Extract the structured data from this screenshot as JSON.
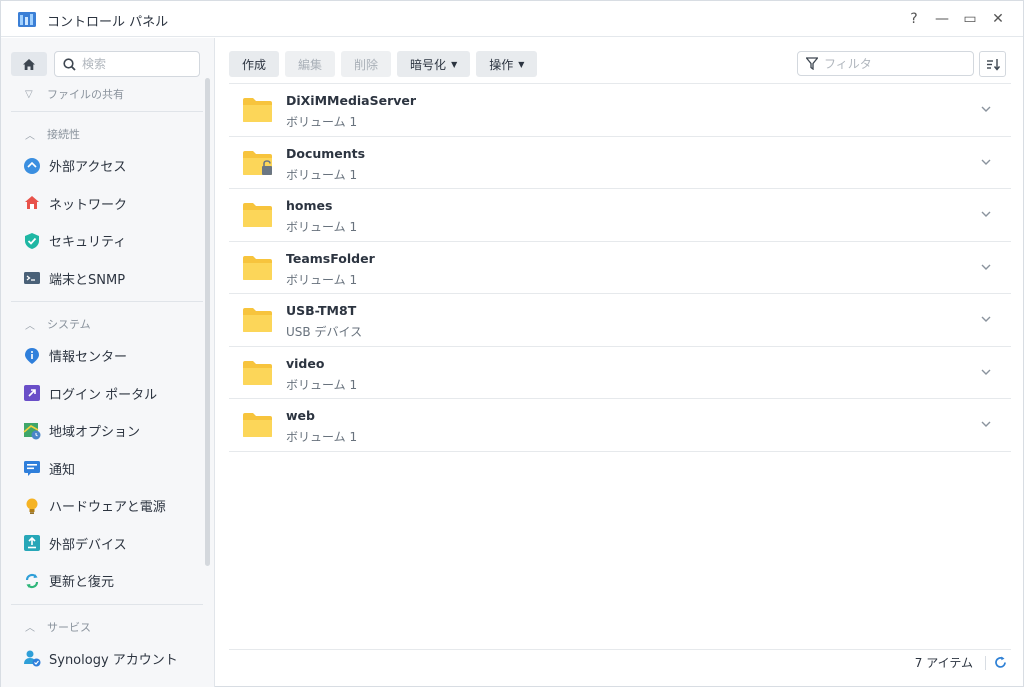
{
  "window": {
    "title": "コントロール パネル",
    "help": "?",
    "minimize": "—",
    "maximize": "▭",
    "close": "✕"
  },
  "sidebar": {
    "search_placeholder": "検索",
    "sections": [
      {
        "label": "ファイルの共有",
        "collapsed": true,
        "items": []
      },
      {
        "label": "接続性",
        "collapsed": false,
        "items": [
          "外部アクセス",
          "ネットワーク",
          "セキュリティ",
          "端末とSNMP"
        ]
      },
      {
        "label": "システム",
        "collapsed": false,
        "items": [
          "情報センター",
          "ログイン ポータル",
          "地域オプション",
          "通知",
          "ハードウェアと電源",
          "外部デバイス",
          "更新と復元"
        ]
      },
      {
        "label": "サービス",
        "collapsed": false,
        "items": [
          "Synology アカウント"
        ]
      }
    ]
  },
  "toolbar": {
    "create": "作成",
    "edit": "編集",
    "delete": "削除",
    "encrypt": "暗号化",
    "action": "操作",
    "filter_placeholder": "フィルタ"
  },
  "folders": [
    {
      "name": "DiXiMMediaServer",
      "sub": "ボリューム 1"
    },
    {
      "name": "Documents",
      "sub": "ボリューム 1"
    },
    {
      "name": "homes",
      "sub": "ボリューム 1"
    },
    {
      "name": "TeamsFolder",
      "sub": "ボリューム 1"
    },
    {
      "name": "USB-TM8T",
      "sub": "USB デバイス"
    },
    {
      "name": "video",
      "sub": "ボリューム 1"
    },
    {
      "name": "web",
      "sub": "ボリューム 1"
    }
  ],
  "footer": {
    "count": "7 アイテム"
  },
  "colors": {
    "folder": "#f7c43d",
    "accent": "#2e80d5"
  }
}
